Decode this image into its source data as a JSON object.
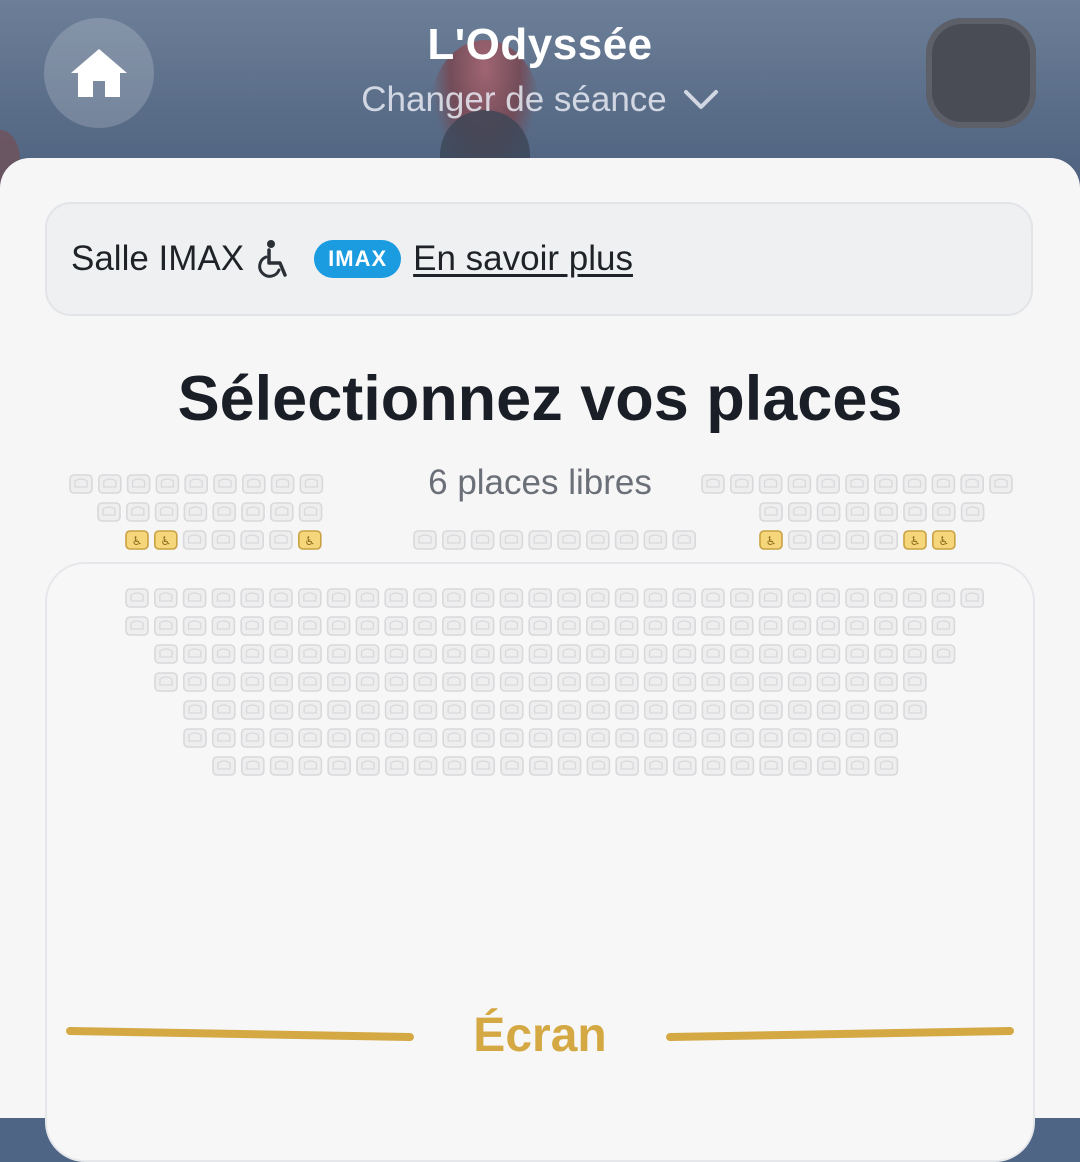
{
  "header": {
    "movie_title": "L'Odyssée",
    "change_session": "Changer de séance",
    "home_icon": "home-icon",
    "chevron_icon": "chevron-down-icon"
  },
  "room": {
    "name": "Salle IMAX",
    "accessibility_icon": "wheelchair-icon",
    "format_badge": "IMAX",
    "learn_more": "En savoir plus"
  },
  "selection": {
    "title": "Sélectionnez vos places",
    "free_seats": "6 places libres"
  },
  "screen": {
    "label": "Écran"
  },
  "colors": {
    "accent_gold": "#d4a843",
    "imax_blue": "#1b9be0",
    "seat_unavailable": "#d9d9dc",
    "seat_accessible": "#f6d67a"
  },
  "seat_map": {
    "rows": [
      {
        "blocks": [
          {
            "count": 9,
            "accessible": []
          },
          {
            "count": 11,
            "accessible": []
          }
        ]
      },
      {
        "blocks": [
          {
            "count": 8,
            "accessible": []
          },
          {
            "count": 8,
            "accessible": []
          }
        ]
      },
      {
        "blocks": [
          {
            "count": 7,
            "accessible": [
              0,
              1,
              6
            ]
          },
          {
            "count": 10,
            "accessible": []
          },
          {
            "count": 7,
            "accessible": [
              0,
              5,
              6
            ]
          }
        ]
      },
      {
        "blocks": [
          {
            "count": 30,
            "accessible": []
          }
        ]
      },
      {
        "blocks": [
          {
            "count": 29,
            "accessible": []
          }
        ]
      },
      {
        "blocks": [
          {
            "count": 28,
            "accessible": []
          }
        ]
      },
      {
        "blocks": [
          {
            "count": 27,
            "accessible": []
          }
        ]
      },
      {
        "blocks": [
          {
            "count": 26,
            "accessible": []
          }
        ]
      },
      {
        "blocks": [
          {
            "count": 25,
            "accessible": []
          }
        ]
      },
      {
        "blocks": [
          {
            "count": 24,
            "accessible": []
          }
        ]
      }
    ]
  }
}
